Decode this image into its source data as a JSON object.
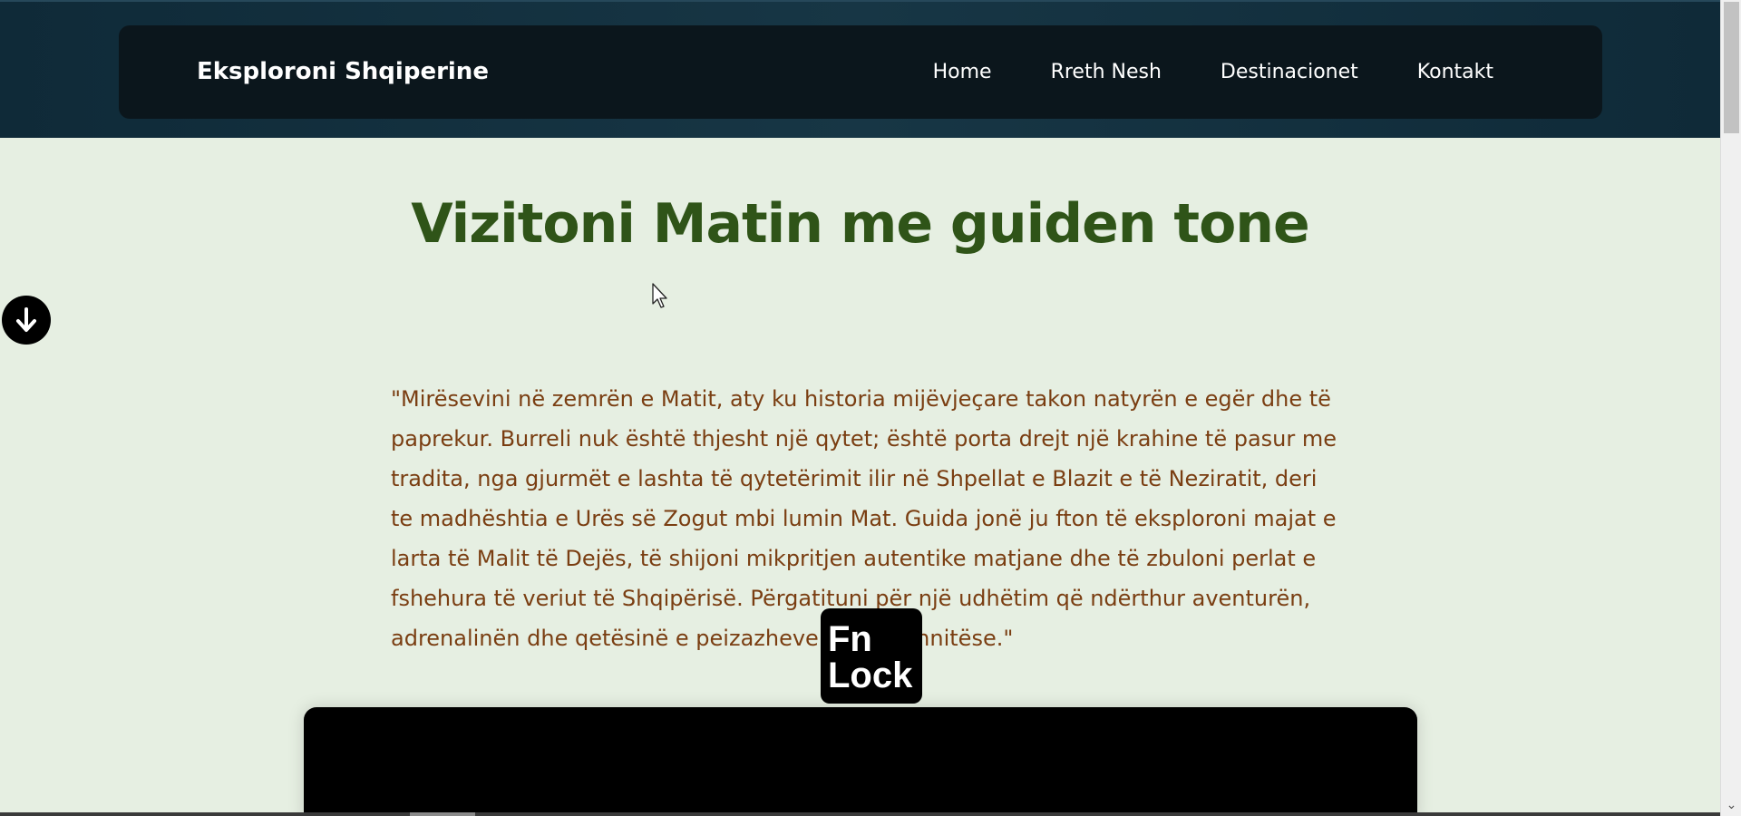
{
  "header": {
    "brand": "Eksploroni Shqiperine",
    "nav": [
      "Home",
      "Rreth Nesh",
      "Destinacionet",
      "Kontakt"
    ]
  },
  "main": {
    "title": "Vizitoni Matin me guiden tone",
    "quote": "\"Mirësevini në zemrën e Matit, aty ku historia mijëvjeçare takon natyrën e egër dhe të paprekur. Burreli nuk është thjesht një qytet; është porta drejt një krahine të pasur me tradita, nga gjurmët e lashta të qytetërimit ilir në Shpellat e Blazit e të Neziratit, deri te madhështia e Urës së Zogut mbi lumin Mat. Guida jonë ju fton të eksploroni majat e larta të Malit të Dejës, të shijoni mikpritjen autentike matjane dhe të zbuloni perlat e fshehura të veriut të Shqipërisë. Përgatituni për një udhëtim që ndërthur aventurën, adrenalinën dhe qetësinë e peizazheve tona mahnitëse.\""
  },
  "overlay": {
    "fn_lock_line1": "Fn",
    "fn_lock_line2": "Lock"
  },
  "icons": {
    "scroll_down": "arrow-down-circle-icon",
    "cursor": "mouse-pointer-icon",
    "scroll_arrow": "chevron-down-icon"
  },
  "colors": {
    "header_bg": "#0f2a38",
    "navbar_bg": "#0b161c",
    "page_bg": "#e6efe2",
    "title": "#2f5418",
    "quote": "#7a3e12"
  }
}
